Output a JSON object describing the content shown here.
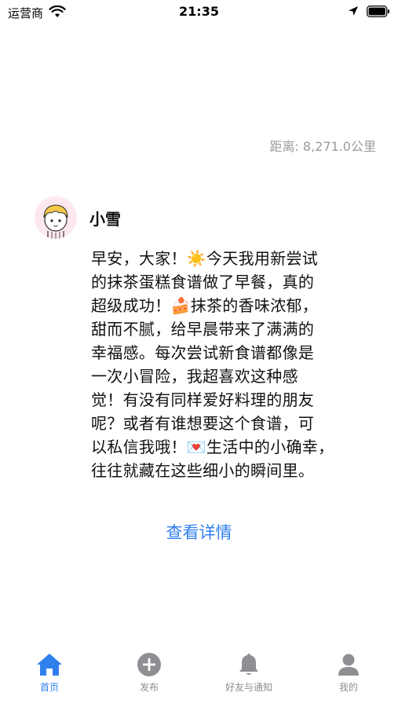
{
  "status_bar": {
    "carrier": "运营商",
    "time": "21:35"
  },
  "distance": "距离: 8,271.0公里",
  "post": {
    "username": "小雪",
    "body": "早安，大家！☀️今天我用新尝试\n的抹茶蛋糕食谱做了早餐，真的\n超级成功！🍰抹茶的香味浓郁，\n甜而不腻，给早晨带来了满满的\n幸福感。每次尝试新食谱都像是\n一次小冒险，我超喜欢这种感\n觉！有没有同样爱好料理的朋友\n呢？或者有谁想要这个食谱，可\n以私信我哦！💌生活中的小确幸，\n往往就藏在这些细小的瞬间里。",
    "details_label": "查看详情"
  },
  "tab_bar": {
    "tabs": [
      {
        "label": "首页",
        "icon": "home-icon",
        "active": true
      },
      {
        "label": "发布",
        "icon": "plus-circle-icon",
        "active": false
      },
      {
        "label": "好友与通知",
        "icon": "bell-icon",
        "active": false
      },
      {
        "label": "我的",
        "icon": "person-icon",
        "active": false
      }
    ]
  },
  "colors": {
    "accent": "#2f80ed",
    "inactive": "#8e8e93",
    "secondary_text": "#9b9b9b"
  }
}
